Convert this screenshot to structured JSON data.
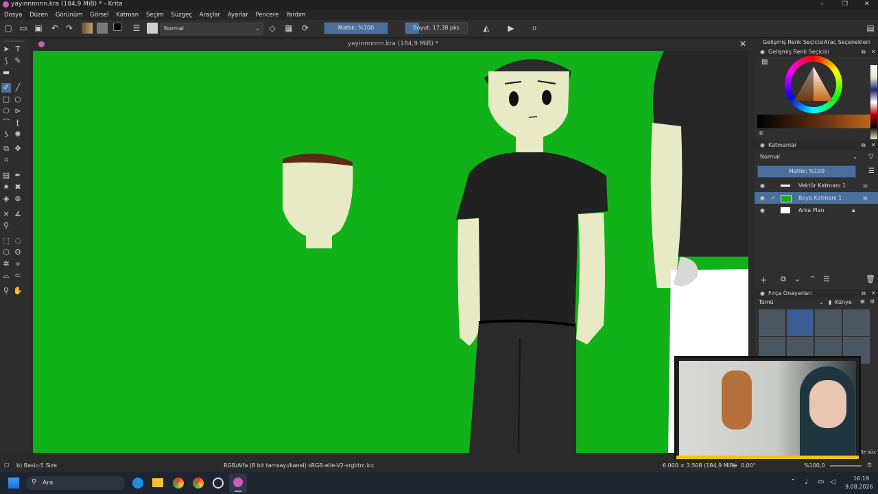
{
  "window": {
    "title": "yayinnnnnn.kra (184,9 MiB) * - Krita",
    "controls": [
      "–",
      "❐",
      "✕"
    ]
  },
  "menu": [
    "Dosya",
    "Düzen",
    "Görünüm",
    "Görsel",
    "Katman",
    "Seçim",
    "Süzgeç",
    "Araçlar",
    "Ayarlar",
    "Pencere",
    "Yardım"
  ],
  "toolbar": {
    "blend_mode": "Normal",
    "opacity": "Matlık: %100",
    "size": "Boyut: 17,38 pks"
  },
  "document_tab": {
    "title": "yayinnnnnn.kra (184,9 MiB) *"
  },
  "dockers": {
    "tabs": [
      "Gelişmiş Renk Seçicisi",
      "Araç Seçenekleri"
    ],
    "color_selector_title": "Gelişmiş Renk Seçicisi",
    "layers": {
      "title": "Katmanlar",
      "blend_mode": "Normal",
      "opacity": "Matlık: %100",
      "items": [
        {
          "name": "Vektör Katmanı 1",
          "selected": false
        },
        {
          "name": "Boya Katmanı 1",
          "selected": true
        },
        {
          "name": "Arka Plan",
          "selected": false
        }
      ]
    },
    "brush_presets": {
      "title": "Fırça Önayarları",
      "filter": "Tümü",
      "tag": "Künye"
    },
    "right_edge_text": "3e süz"
  },
  "status": {
    "brush": "b) Basic-5 Size",
    "color_profile": "RGB/Alfa (8 bit tamsayı/kanal) sRGB-elle-V2-srgbtrc.icc",
    "image_size": "6.000 × 3.508 (184,9 MiB)",
    "rotation": "0,00°",
    "zoom": "%100,0"
  },
  "taskbar": {
    "search": "Ara",
    "time": "16:19",
    "date": "9.08.2026"
  },
  "colors": {
    "canvas_bg": "#11b11a",
    "skin": "#e8e9c5",
    "shirt": "#212121",
    "accent": "#4a6f9c"
  }
}
